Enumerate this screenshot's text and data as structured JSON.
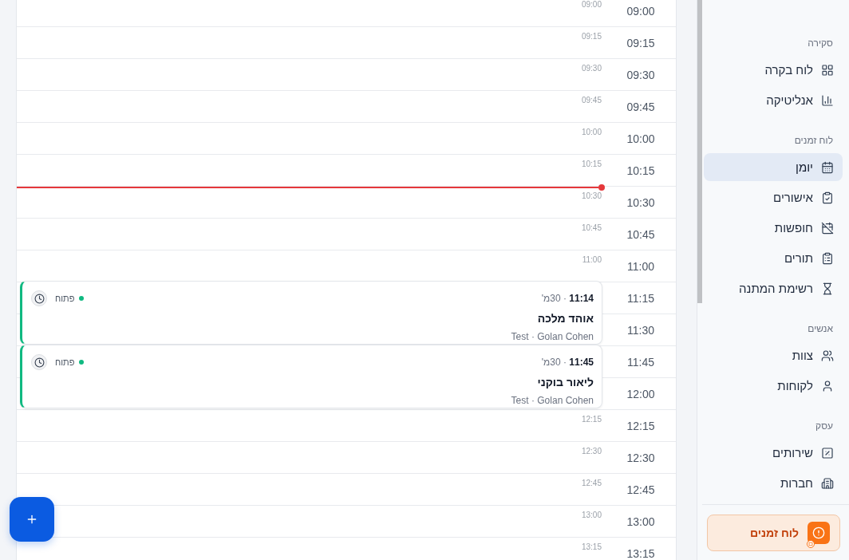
{
  "calendar": {
    "slots": [
      {
        "time": "09:00",
        "mini_label": "09:00",
        "now_line": false
      },
      {
        "time": "09:15",
        "mini_label": "09:15",
        "now_line": false
      },
      {
        "time": "09:30",
        "mini_label": "09:30",
        "now_line": false
      },
      {
        "time": "09:45",
        "mini_label": "09:45",
        "now_line": false
      },
      {
        "time": "10:00",
        "mini_label": "10:00",
        "now_line": false
      },
      {
        "time": "10:15",
        "mini_label": "10:15",
        "now_line": false
      },
      {
        "time": "10:30",
        "mini_label": "10:30",
        "now_line": true
      },
      {
        "time": "10:45",
        "mini_label": "10:45",
        "now_line": false
      },
      {
        "time": "11:00",
        "mini_label": "11:00",
        "now_line": false
      },
      {
        "time": "11:15",
        "now_line": false,
        "events": [
          {
            "when": "**11:14** · 30מ'",
            "title": "אוהד מלכה",
            "meta": "Test · Golan Cohen",
            "status": "פתוח",
            "color": "#10b981"
          }
        ]
      },
      {
        "time": "11:30",
        "now_line": false
      },
      {
        "time": "11:45",
        "now_line": false,
        "events": [
          {
            "when": "**11:45** · 30מ'",
            "title": "ליאור בוקני",
            "meta": "Test · Golan Cohen",
            "status": "פתוח",
            "color": "#10b981"
          }
        ]
      },
      {
        "time": "12:00",
        "now_line": false
      },
      {
        "time": "12:15",
        "mini_label": "12:15",
        "now_line": false
      },
      {
        "time": "12:30",
        "mini_label": "12:30",
        "now_line": false
      },
      {
        "time": "12:45",
        "mini_label": "12:45",
        "now_line": false
      },
      {
        "time": "13:00",
        "mini_label": "13:00",
        "now_line": false
      },
      {
        "time": "13:15",
        "mini_label": "13:15",
        "now_line": false
      }
    ]
  },
  "sidebar": {
    "sections": [
      {
        "title": "סקירה",
        "items": [
          {
            "label": "לוח בקרה",
            "selected": false
          },
          {
            "label": "אנליטיקה",
            "selected": false
          }
        ]
      },
      {
        "title": "לוח זמנים",
        "items": [
          {
            "label": "יומן",
            "selected": true
          },
          {
            "label": "אישורים",
            "selected": false
          },
          {
            "label": "חופשות",
            "selected": false
          },
          {
            "label": "תורים",
            "selected": false
          },
          {
            "label": "רשימת המתנה",
            "selected": false
          }
        ]
      },
      {
        "title": "אנשים",
        "items": [
          {
            "label": "צוות",
            "selected": false
          },
          {
            "label": "לקוחות",
            "selected": false
          }
        ]
      },
      {
        "title": "עסק",
        "items": [
          {
            "label": "שירותים",
            "selected": false
          },
          {
            "label": "חברות",
            "selected": false
          }
        ]
      }
    ],
    "notice": {
      "label": "לוח זמנים"
    }
  }
}
